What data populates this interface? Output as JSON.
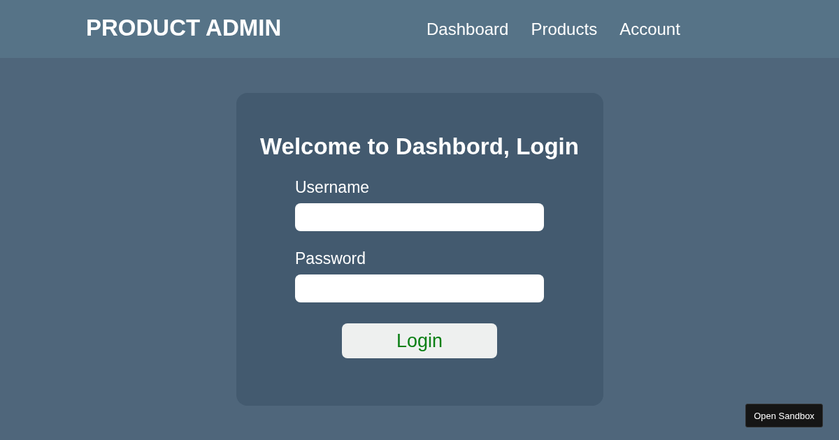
{
  "header": {
    "logo": "PRODUCT ADMIN",
    "nav": [
      {
        "label": "Dashboard"
      },
      {
        "label": "Products"
      },
      {
        "label": "Account"
      }
    ]
  },
  "login": {
    "title": "Welcome to Dashbord, Login",
    "fields": [
      {
        "label": "Username"
      },
      {
        "label": "Password"
      }
    ],
    "button": "Login"
  },
  "sandbox_button": "Open Sandbox"
}
